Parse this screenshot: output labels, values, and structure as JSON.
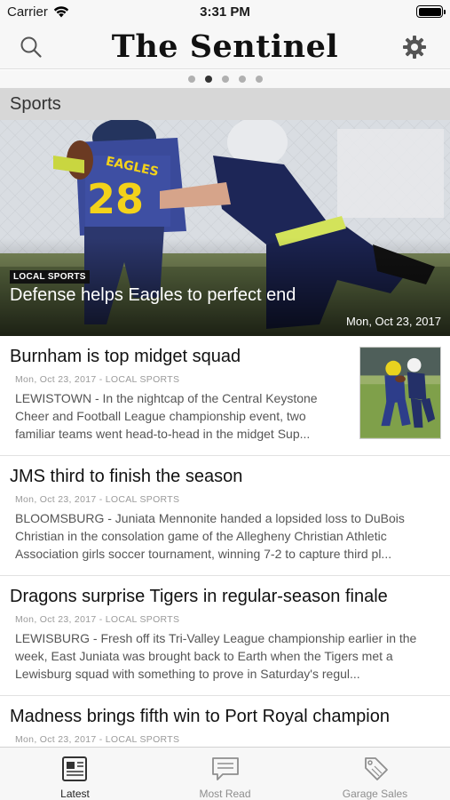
{
  "status": {
    "carrier": "Carrier",
    "time": "3:31 PM",
    "battery_level": 1.0
  },
  "header": {
    "title": "The Sentinel",
    "search_icon": "search-icon",
    "settings_icon": "gear-icon"
  },
  "pager": {
    "count": 5,
    "active_index": 1
  },
  "section": {
    "title": "Sports"
  },
  "hero": {
    "category": "LOCAL SPORTS",
    "title": "Defense helps Eagles to perfect end",
    "date": "Mon, Oct 23, 2017"
  },
  "articles": [
    {
      "title": "Burnham is top midget squad",
      "meta": "Mon, Oct 23, 2017 - LOCAL SPORTS",
      "summary": "LEWISTOWN - In the nightcap of the Central Keystone Cheer and Football League championship event, two familiar teams went head-to-head in the midget Sup...",
      "has_thumb": true
    },
    {
      "title": "JMS third to finish the season",
      "meta": "Mon, Oct 23, 2017 - LOCAL SPORTS",
      "summary": "BLOOMSBURG - Juniata Mennonite handed a lopsided loss to DuBois Christian in the consolation game of the Allegheny Christian Athletic Association girls soccer tournament, winning 7-2 to capture third pl..."
    },
    {
      "title": "Dragons surprise Tigers in regular-season finale",
      "meta": "Mon, Oct 23, 2017 - LOCAL SPORTS",
      "summary": "LEWISBURG - Fresh off its Tri-Valley League championship earlier in the week, East Juniata was brought back to Earth when the Tigers met a Lewisburg squad with something to prove in Saturday's regul..."
    },
    {
      "title": "Madness brings fifth win to Port Royal champion",
      "meta": "Mon, Oct 23, 2017 - LOCAL SPORTS",
      "summary": ""
    }
  ],
  "tabs": [
    {
      "label": "Latest",
      "icon": "newspaper-icon",
      "active": true
    },
    {
      "label": "Most Read",
      "icon": "message-icon",
      "active": false
    },
    {
      "label": "Garage Sales",
      "icon": "price-tag-icon",
      "active": false
    }
  ],
  "photo": {
    "jersey_number": "28",
    "jersey_text": "EAGLES"
  },
  "colors": {
    "accent": "#222222",
    "inactive": "#8e8e8e",
    "section_bg": "#d7d7d7"
  }
}
